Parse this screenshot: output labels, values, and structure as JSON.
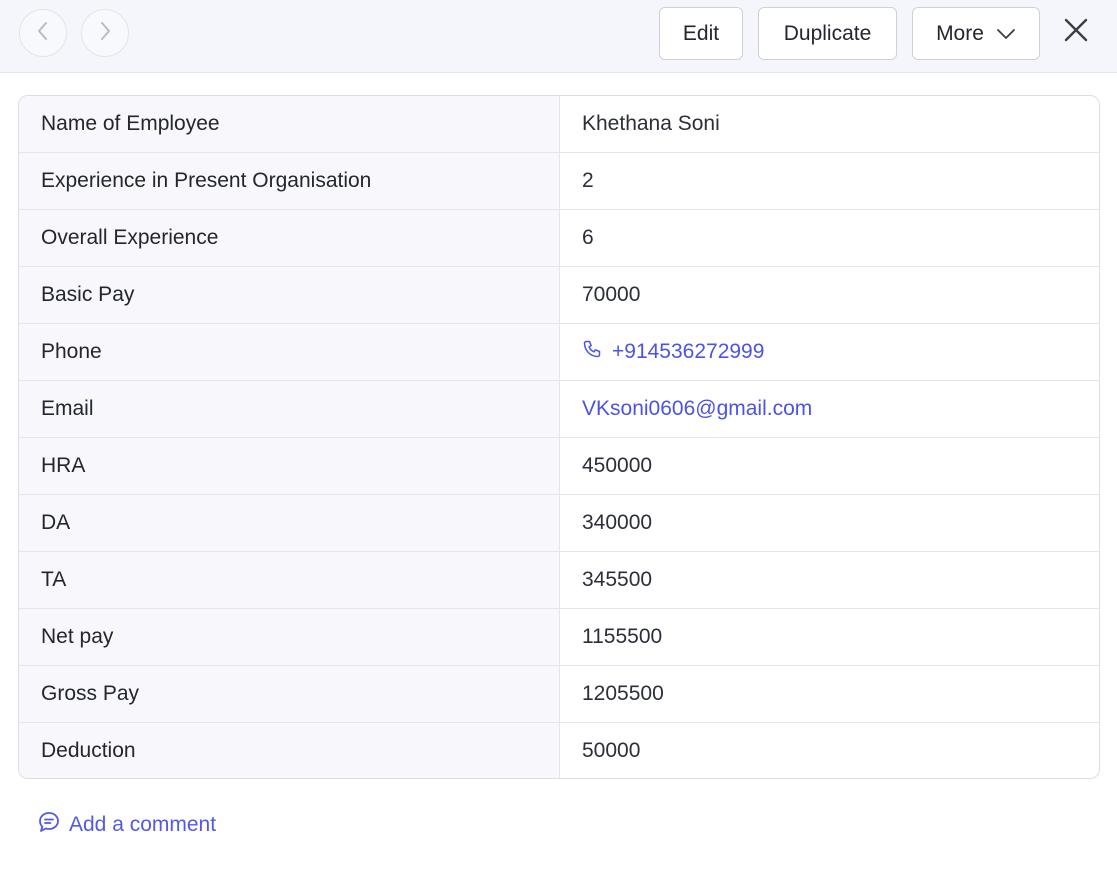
{
  "toolbar": {
    "prev_icon": "chevron-left-icon",
    "next_icon": "chevron-right-icon",
    "edit_label": "Edit",
    "duplicate_label": "Duplicate",
    "more_label": "More",
    "close_icon": "close-icon"
  },
  "record": {
    "rows": [
      {
        "label": "Name of Employee",
        "value": "Khethana Soni"
      },
      {
        "label": "Experience in Present Organisation",
        "value": "2"
      },
      {
        "label": "Overall Experience",
        "value": "6"
      },
      {
        "label": "Basic Pay",
        "value": "70000"
      },
      {
        "label": "Phone",
        "value": "+914536272999",
        "icon": "phone-icon"
      },
      {
        "label": "Email",
        "value": "VKsoni0606@gmail.com"
      },
      {
        "label": "HRA",
        "value": "450000"
      },
      {
        "label": "DA",
        "value": "340000"
      },
      {
        "label": "TA",
        "value": "345500"
      },
      {
        "label": "Net pay",
        "value": "1155500"
      },
      {
        "label": "Gross Pay",
        "value": "1205500"
      },
      {
        "label": "Deduction",
        "value": "50000"
      }
    ]
  },
  "comment": {
    "label": "Add a comment",
    "icon": "comment-icon"
  },
  "colors": {
    "accent": "#4c53e6",
    "topbar_bg": "#f5f6fb",
    "label_bg": "#f8f8fc"
  }
}
